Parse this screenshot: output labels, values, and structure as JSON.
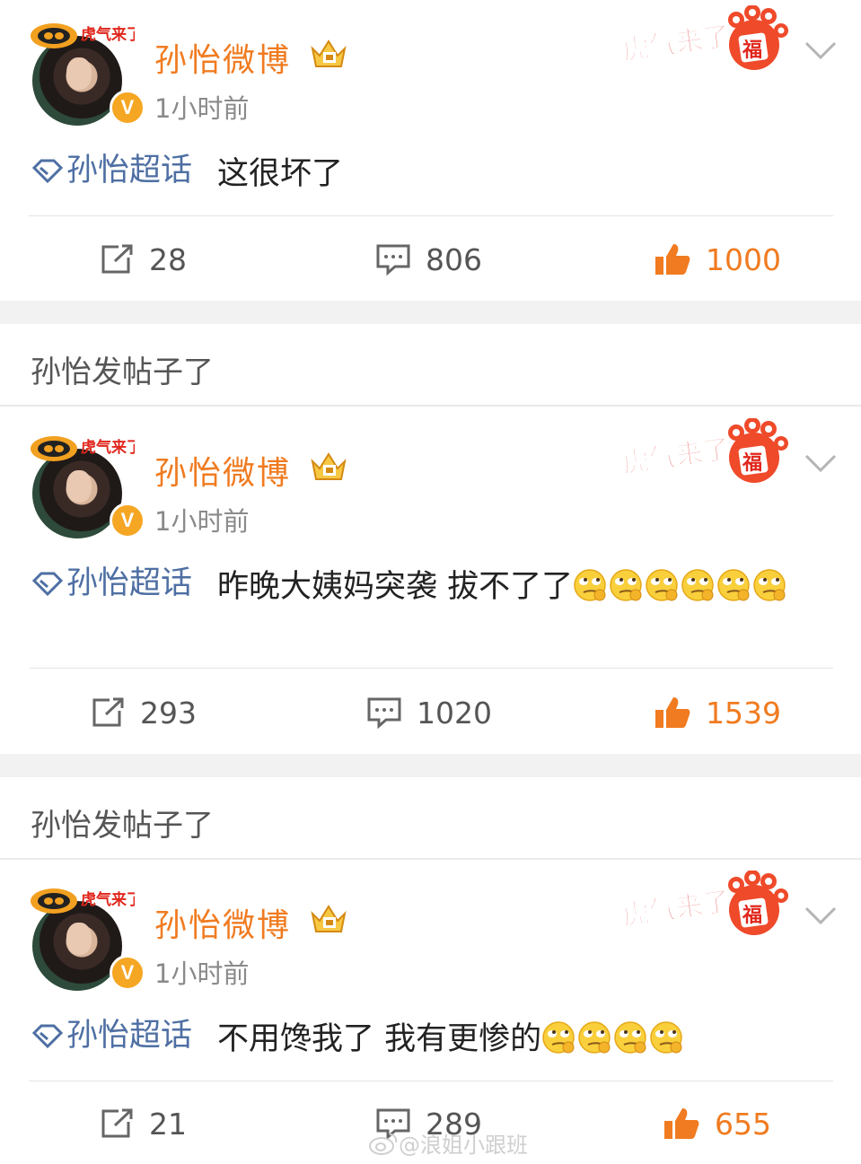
{
  "repost_label": "孙怡发帖子了",
  "posts": [
    {
      "username": "孙怡微博",
      "time": "1小时前",
      "topic": "孙怡超话",
      "text": "这很坏了",
      "emoji_count": 0,
      "repost_count": "28",
      "comment_count": "806",
      "like_count": "1000"
    },
    {
      "username": "孙怡微博",
      "time": "1小时前",
      "topic": "孙怡超话",
      "text": "昨晚大姨妈突袭 拔不了了",
      "emoji_count": 6,
      "repost_count": "293",
      "comment_count": "1020",
      "like_count": "1539"
    },
    {
      "username": "孙怡微博",
      "time": "1小时前",
      "topic": "孙怡超话",
      "text": "不用馋我了 我有更惨的",
      "emoji_count": 4,
      "repost_count": "21",
      "comment_count": "289",
      "like_count": "655"
    }
  ],
  "banner_text": "虎气来了",
  "banner_badge": "福",
  "avatar_frame_text": "虎气来了",
  "verified_badge": "V",
  "watermark": "@浪姐小跟班",
  "colors": {
    "accent_orange": "#f07b20",
    "topic_blue": "#4e6fa3",
    "verified_gold": "#f5a623"
  }
}
